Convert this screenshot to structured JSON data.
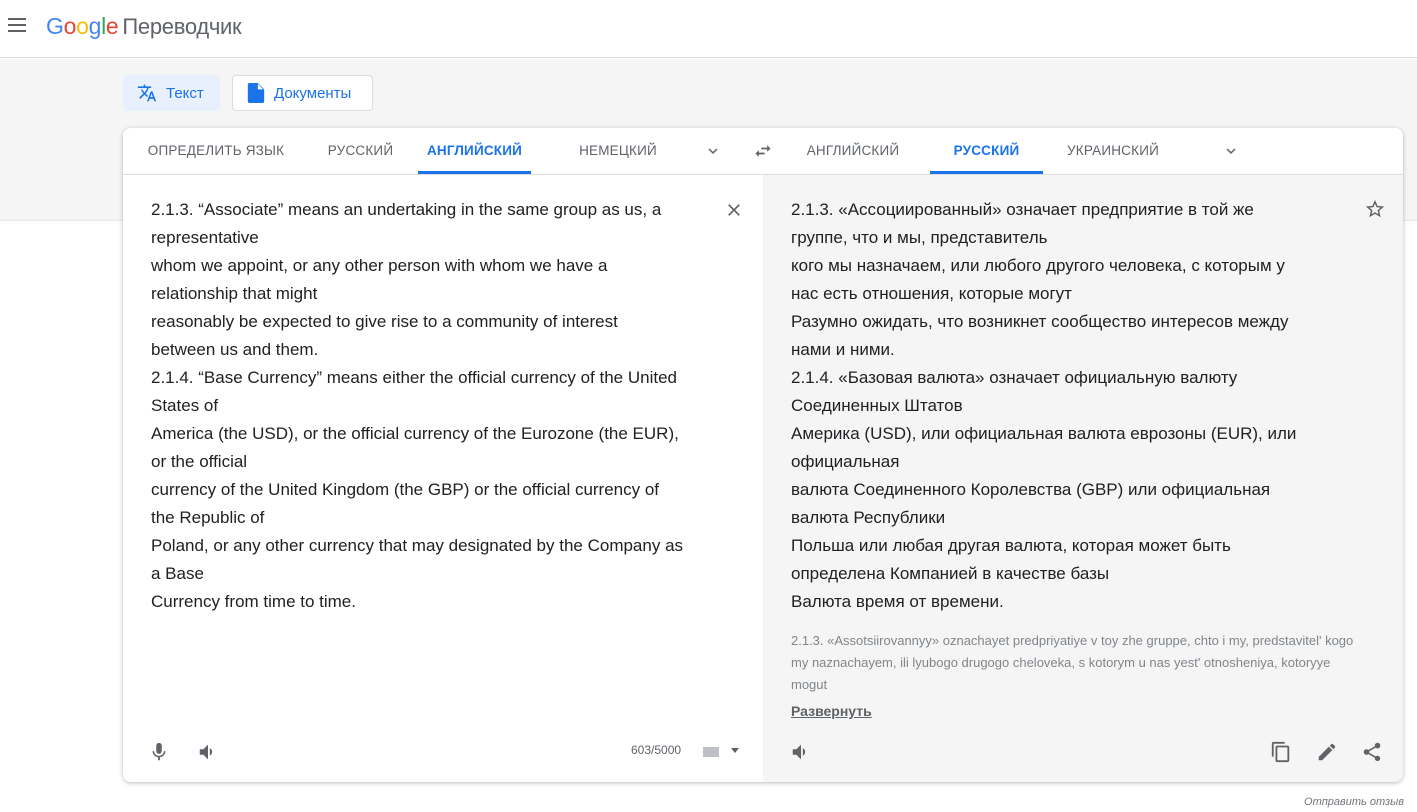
{
  "header": {
    "logo": {
      "G": "G",
      "o1": "o",
      "o2": "o",
      "g": "g",
      "l": "l",
      "e": "e"
    },
    "product": "Переводчик"
  },
  "modes": {
    "text": "Текст",
    "documents": "Документы"
  },
  "source_tabs": [
    "ОПРЕДЕЛИТЬ ЯЗЫК",
    "РУССКИЙ",
    "АНГЛИЙСКИЙ",
    "НЕМЕЦКИЙ"
  ],
  "target_tabs": [
    "АНГЛИЙСКИЙ",
    "РУССКИЙ",
    "УКРАИНСКИЙ"
  ],
  "source": {
    "lines": [
      "2.1.3. “Associate” means an undertaking in the same group as us, a",
      "representative",
      "whom we appoint, or any other person with whom we have a",
      "relationship that might",
      "reasonably be expected to give rise to a community of interest",
      "between us and them.",
      "2.1.4. “Base Currency” means either the official currency of the United",
      "States of",
      "America (the USD), or the official currency of the Eurozone (the EUR),",
      "or the official",
      "currency of the United Kingdom (the GBP) or the official currency of",
      "the Republic of",
      "Poland, or any other currency that may designated by the Company as",
      "a Base",
      "Currency from time to time."
    ],
    "char_count": "603/5000"
  },
  "target": {
    "lines": [
      "2.1.3. «Ассоциированный» означает предприятие в той же",
      "группе, что и мы, представитель",
      "кого мы назначаем, или любого другого человека, с которым у",
      "нас есть отношения, которые могут",
      "Разумно ожидать, что возникнет сообщество интересов между",
      "нами и ними.",
      "2.1.4. «Базовая валюта» означает официальную валюту",
      "Соединенных Штатов",
      "Америка (USD), или официальная валюта еврозоны (EUR), или",
      "официальная",
      "валюта Соединенного Королевства (GBP) или официальная",
      "валюта Республики",
      "Польша или любая другая валюта, которая может быть",
      "определена Компанией в качестве базы",
      "Валюта время от времени."
    ],
    "transliteration": "2.1.3. «Assotsiirovannyy» oznachayet predpriyatiye v toy zhe gruppe, chto i my, predstavitel' kogo my naznachayem, ili lyubogo drugogo cheloveka, s kotorym u nas yest' otnosheniya, kotoryye mogut",
    "expand": "Развернуть"
  },
  "footer": {
    "feedback": "Отправить отзыв"
  }
}
